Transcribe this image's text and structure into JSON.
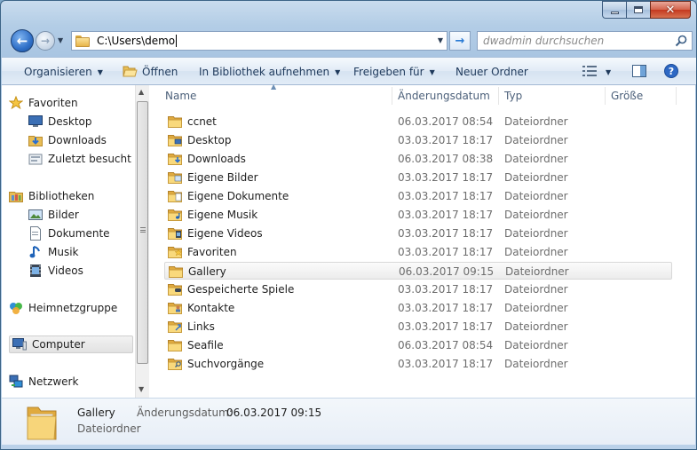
{
  "window": {
    "minimize_glyph": "",
    "close_glyph": "✕"
  },
  "nav": {
    "back_glyph": "←",
    "forward_glyph": "→",
    "address": "C:\\Users\\demo",
    "go_glyph": "→"
  },
  "search": {
    "placeholder": "dwadmin durchsuchen"
  },
  "toolbar": {
    "organize": "Organisieren",
    "open": "Öffnen",
    "include_library": "In Bibliothek aufnehmen",
    "share": "Freigeben für",
    "new_folder": "Neuer Ordner"
  },
  "sidebar": {
    "favorites": {
      "label": "Favoriten",
      "items": [
        {
          "label": "Desktop",
          "icon": "desktop-icon"
        },
        {
          "label": "Downloads",
          "icon": "downloads-icon"
        },
        {
          "label": "Zuletzt besucht",
          "icon": "recent-icon"
        }
      ]
    },
    "libraries": {
      "label": "Bibliotheken",
      "items": [
        {
          "label": "Bilder",
          "icon": "pictures-icon"
        },
        {
          "label": "Dokumente",
          "icon": "documents-icon"
        },
        {
          "label": "Musik",
          "icon": "music-icon"
        },
        {
          "label": "Videos",
          "icon": "videos-icon"
        }
      ]
    },
    "homegroup": "Heimnetzgruppe",
    "computer": "Computer",
    "network": "Netzwerk"
  },
  "columns": {
    "name": "Name",
    "date": "Änderungsdatum",
    "type": "Typ",
    "size": "Größe"
  },
  "files": [
    {
      "name": "ccnet",
      "date": "06.03.2017 08:54",
      "type": "Dateiordner",
      "icon": "folder-icon"
    },
    {
      "name": "Desktop",
      "date": "03.03.2017 18:17",
      "type": "Dateiordner",
      "icon": "desktop-folder-icon"
    },
    {
      "name": "Downloads",
      "date": "06.03.2017 08:38",
      "type": "Dateiordner",
      "icon": "downloads-folder-icon"
    },
    {
      "name": "Eigene Bilder",
      "date": "03.03.2017 18:17",
      "type": "Dateiordner",
      "icon": "pictures-folder-icon"
    },
    {
      "name": "Eigene Dokumente",
      "date": "03.03.2017 18:17",
      "type": "Dateiordner",
      "icon": "documents-folder-icon"
    },
    {
      "name": "Eigene Musik",
      "date": "03.03.2017 18:17",
      "type": "Dateiordner",
      "icon": "music-folder-icon"
    },
    {
      "name": "Eigene Videos",
      "date": "03.03.2017 18:17",
      "type": "Dateiordner",
      "icon": "videos-folder-icon"
    },
    {
      "name": "Favoriten",
      "date": "03.03.2017 18:17",
      "type": "Dateiordner",
      "icon": "favorites-folder-icon"
    },
    {
      "name": "Gallery",
      "date": "06.03.2017 09:15",
      "type": "Dateiordner",
      "icon": "folder-icon",
      "selected": true
    },
    {
      "name": "Gespeicherte Spiele",
      "date": "03.03.2017 18:17",
      "type": "Dateiordner",
      "icon": "saved-games-folder-icon"
    },
    {
      "name": "Kontakte",
      "date": "03.03.2017 18:17",
      "type": "Dateiordner",
      "icon": "contacts-folder-icon"
    },
    {
      "name": "Links",
      "date": "03.03.2017 18:17",
      "type": "Dateiordner",
      "icon": "links-folder-icon"
    },
    {
      "name": "Seafile",
      "date": "06.03.2017 08:54",
      "type": "Dateiordner",
      "icon": "folder-icon"
    },
    {
      "name": "Suchvorgänge",
      "date": "03.03.2017 18:17",
      "type": "Dateiordner",
      "icon": "searches-folder-icon"
    }
  ],
  "details": {
    "name": "Gallery",
    "type": "Dateiordner",
    "date_label": "Änderungsdatum:",
    "date_value": "06.03.2017 09:15"
  },
  "colors": {
    "accent": "#2f6fc7",
    "toolbar_text": "#1e395b",
    "muted_text": "#6d6d6d"
  }
}
